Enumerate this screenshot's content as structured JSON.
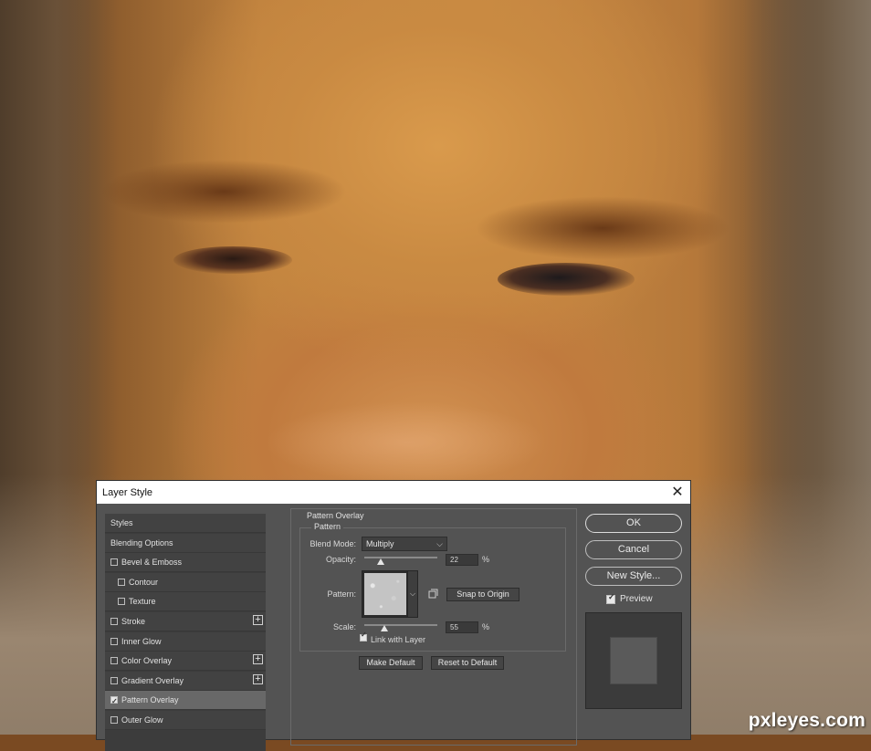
{
  "watermark": "pxleyes.com",
  "dialog": {
    "title": "Layer Style",
    "close_glyph": "✕",
    "styles_list": [
      {
        "label": "Styles",
        "checkbox": null,
        "plus": false,
        "selected": false
      },
      {
        "label": "Blending Options",
        "checkbox": null,
        "plus": false,
        "selected": false
      },
      {
        "label": "Bevel & Emboss",
        "checkbox": false,
        "plus": false,
        "selected": false
      },
      {
        "label": "Contour",
        "checkbox": false,
        "plus": false,
        "selected": false,
        "indent": true
      },
      {
        "label": "Texture",
        "checkbox": false,
        "plus": false,
        "selected": false,
        "indent": true
      },
      {
        "label": "Stroke",
        "checkbox": false,
        "plus": true,
        "selected": false
      },
      {
        "label": "Inner Glow",
        "checkbox": false,
        "plus": false,
        "selected": false
      },
      {
        "label": "Color Overlay",
        "checkbox": false,
        "plus": true,
        "selected": false
      },
      {
        "label": "Gradient Overlay",
        "checkbox": false,
        "plus": true,
        "selected": false
      },
      {
        "label": "Pattern Overlay",
        "checkbox": true,
        "plus": false,
        "selected": true
      },
      {
        "label": "Outer Glow",
        "checkbox": false,
        "plus": false,
        "selected": false
      }
    ],
    "plus_glyph": "+",
    "section_title": "Pattern Overlay",
    "group_title": "Pattern",
    "blend_mode_label": "Blend Mode:",
    "blend_mode_value": "Multiply",
    "opacity_label": "Opacity:",
    "opacity_value": "22",
    "opacity_fraction": 0.22,
    "percent": "%",
    "pattern_label": "Pattern:",
    "snap_to_origin": "Snap to Origin",
    "scale_label": "Scale:",
    "scale_value": "55",
    "scale_fraction": 0.27,
    "link_with_layer": "Link with Layer",
    "link_checked": true,
    "make_default": "Make Default",
    "reset_to_default": "Reset to Default",
    "ok": "OK",
    "cancel": "Cancel",
    "new_style": "New Style...",
    "preview_label": "Preview",
    "preview_checked": true
  }
}
